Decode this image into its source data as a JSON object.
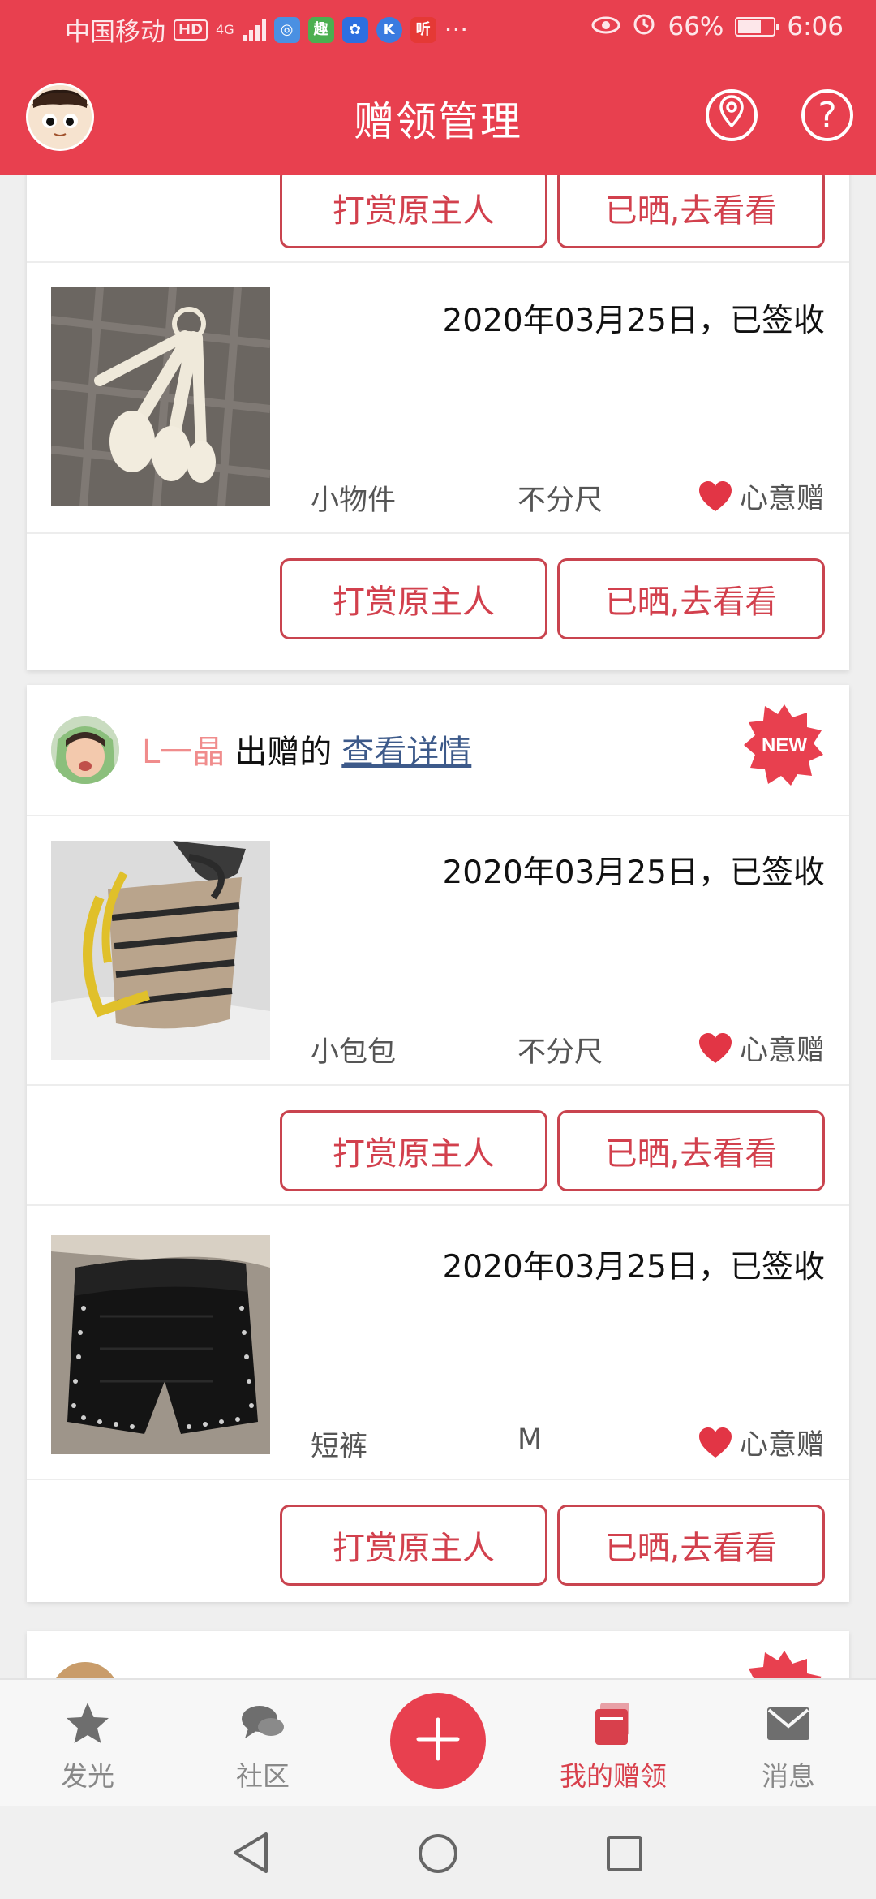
{
  "status_bar": {
    "carrier": "中国移动",
    "hd_badge": "HD",
    "network": "4G",
    "app_icons": [
      "browser",
      "趣",
      "baidu",
      "K",
      "听"
    ],
    "more": "···",
    "battery_percent": "66%",
    "time": "6:06"
  },
  "header": {
    "title": "赠领管理",
    "location_icon": "location-pin-icon",
    "help_icon": "?"
  },
  "item_buttons": {
    "reward": "打赏原主人",
    "share": "已晒,去看看"
  },
  "cards": [
    {
      "items": [
        {
          "date_status": "2020年03月25日，已签收",
          "category": "小物件",
          "size": "不分尺",
          "type": "心意赠",
          "thumb": "measuring-spoons"
        }
      ]
    },
    {
      "giver": {
        "name": "L一晶",
        "action": "出赠的",
        "link": "查看详情",
        "badge": "NEW"
      },
      "items": [
        {
          "date_status": "2020年03月25日，已签收",
          "category": "小包包",
          "size": "不分尺",
          "type": "心意赠",
          "thumb": "bucket-bag"
        },
        {
          "date_status": "2020年03月25日，已签收",
          "category": "短裤",
          "size": "M",
          "type": "心意赠",
          "thumb": "black-shorts"
        }
      ]
    }
  ],
  "bottom_nav": {
    "items": [
      {
        "label": "发光",
        "icon": "star-icon"
      },
      {
        "label": "社区",
        "icon": "chat-bubbles-icon"
      },
      {
        "label": "",
        "icon": "plus-icon"
      },
      {
        "label": "我的赠领",
        "icon": "gift-cards-icon",
        "active": true
      },
      {
        "label": "消息",
        "icon": "envelope-icon"
      }
    ]
  },
  "colors": {
    "brand": "#e8404f",
    "button_border": "#c9444f",
    "active_nav": "#d8404c",
    "link": "#3d5a8a"
  }
}
